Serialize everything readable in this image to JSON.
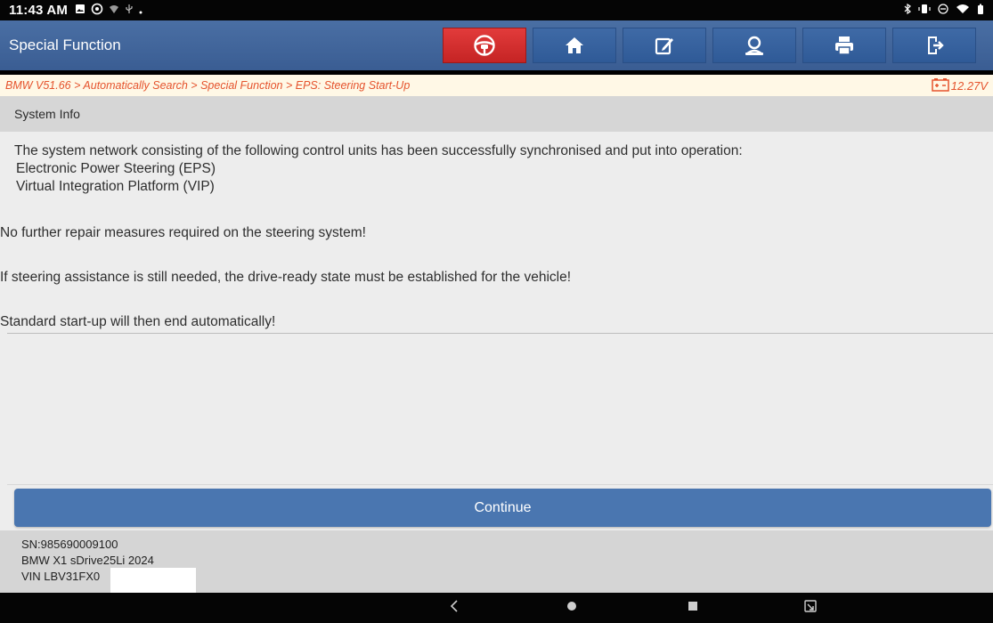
{
  "status_bar": {
    "time": "11:43 AM",
    "left_icons": [
      "gallery-icon",
      "settings-icon",
      "wifi-calling-icon",
      "usb-icon",
      "dot-icon"
    ],
    "right_icons": [
      "bluetooth-icon",
      "vibrate-icon",
      "dnd-icon",
      "wifi-icon",
      "battery-icon"
    ]
  },
  "header": {
    "title": "Special Function",
    "toolbar": [
      {
        "name": "vehicle-diagnosis-button",
        "icon": "steering-wheel-icon",
        "color": "#d52f2f"
      },
      {
        "name": "home-button",
        "icon": "home-icon"
      },
      {
        "name": "edit-report-button",
        "icon": "edit-icon"
      },
      {
        "name": "remote-help-button",
        "icon": "support-agent-icon"
      },
      {
        "name": "print-button",
        "icon": "printer-icon"
      },
      {
        "name": "exit-button",
        "icon": "exit-icon"
      }
    ]
  },
  "breadcrumb": {
    "path": "BMW V51.66 > Automatically Search > Special Function > EPS: Steering Start-Up",
    "voltage": "12.27V",
    "accent": "#e5532d"
  },
  "section": {
    "title": "System Info"
  },
  "message": {
    "intro": "The system network consisting of the following control units has been successfully synchronised and put into operation:",
    "units": [
      "Electronic Power Steering (EPS)",
      "Virtual Integration Platform (VIP)"
    ],
    "paragraphs": [
      "No further repair measures required on the steering system!",
      "If steering assistance is still needed, the drive-ready state must be established for the vehicle!",
      "Standard start-up will then end automatically!"
    ]
  },
  "actions": {
    "continue_label": "Continue"
  },
  "vehicle_info": {
    "sn": "SN:985690009100",
    "model": "BMW X1 sDrive25Li 2024",
    "vin": "VIN LBV31FX0"
  },
  "nav_bar": {
    "buttons": [
      "back-icon",
      "home-circle-icon",
      "recents-icon",
      "screenshot-icon"
    ]
  }
}
